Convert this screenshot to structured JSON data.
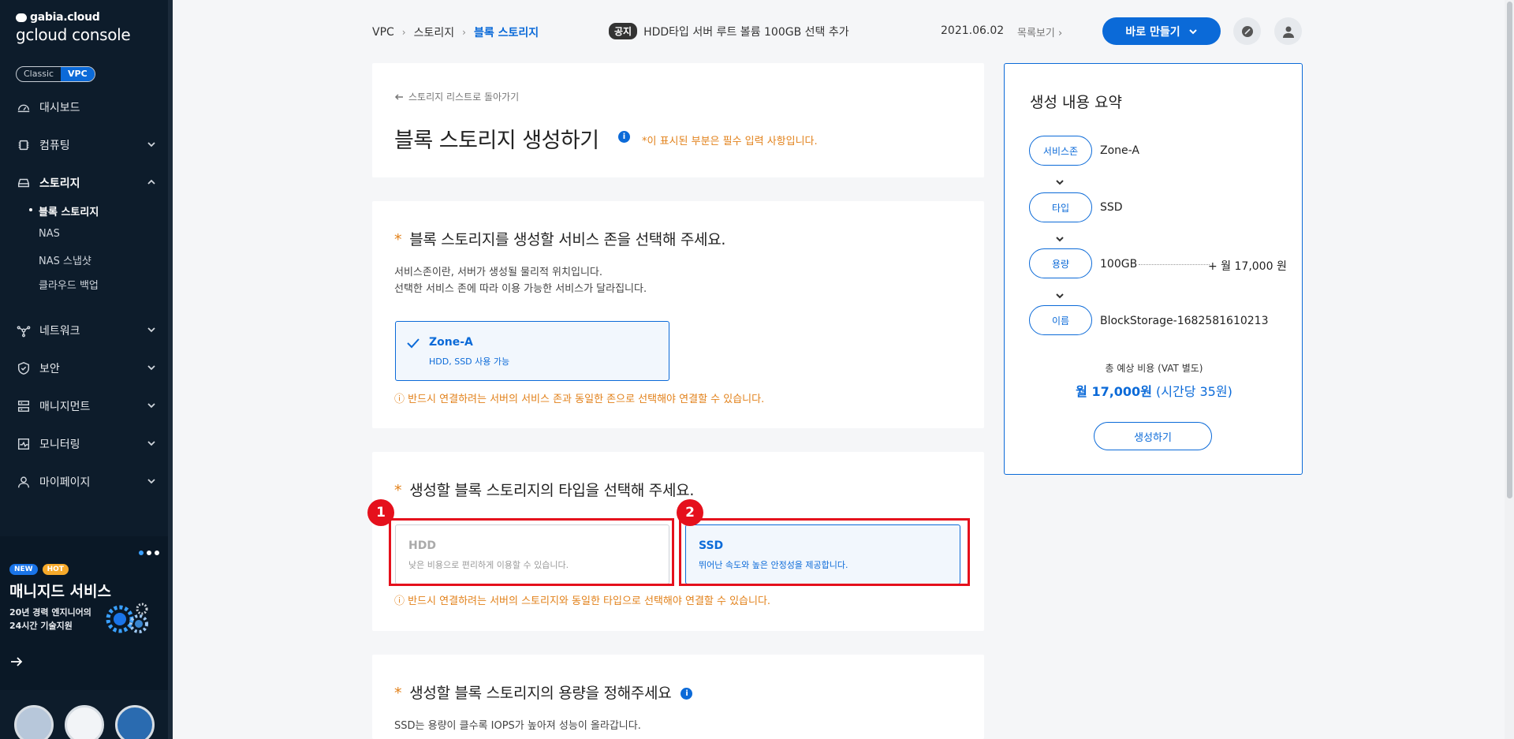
{
  "sidebar": {
    "logo_top": "gabia.cloud",
    "logo_bottom": "gcloud console",
    "toggle": {
      "classic": "Classic",
      "vpc": "VPC"
    },
    "items": [
      {
        "label": "대시보드",
        "icon": "dashboard-icon"
      },
      {
        "label": "컴퓨팅",
        "icon": "cpu-icon"
      },
      {
        "label": "스토리지",
        "icon": "storage-icon"
      },
      {
        "label": "네트워크",
        "icon": "network-icon"
      },
      {
        "label": "보안",
        "icon": "shield-icon"
      },
      {
        "label": "매니지먼트",
        "icon": "management-icon"
      },
      {
        "label": "모니터링",
        "icon": "monitor-icon"
      },
      {
        "label": "마이페이지",
        "icon": "user-icon"
      }
    ],
    "storage_sub": [
      "블록 스토리지",
      "NAS",
      "NAS 스냅샷",
      "클라우드 백업"
    ],
    "promo": {
      "badge_new": "NEW",
      "badge_hot": "HOT",
      "title": "매니지드 서비스",
      "desc1": "20년 경력 엔지니어의",
      "desc2": "24시간 기술지원"
    }
  },
  "topbar": {
    "crumbs": [
      "VPC",
      "스토리지",
      "블록 스토리지"
    ],
    "notice_tag": "공지",
    "notice_text": "HDD타입 서버 루트 볼륨 100GB 선택 추가",
    "notice_date": "2021.06.02",
    "notice_list": "목록보기",
    "make_button": "바로 만들기"
  },
  "header_card": {
    "back_link": "스토리지 리스트로 돌아가기",
    "title": "블록 스토리지 생성하기",
    "required_note": "*이 표시된 부분은 필수 입력 사항입니다."
  },
  "zone_section": {
    "title": "블록 스토리지를 생성할 서비스 존을 선택해 주세요.",
    "desc1": "서비스존이란, 서버가 생성될 물리적 위치입니다.",
    "desc2": "선택한 서비스 존에 따라 이용 가능한 서비스가 달라집니다.",
    "option_name": "Zone-A",
    "option_desc": "HDD, SSD 사용 가능",
    "warning": "ⓘ 반드시 연결하려는 서버의 서비스 존과 동일한 존으로 선택해야 연결할 수 있습니다."
  },
  "type_section": {
    "title": "생성할 블록 스토리지의 타입을 선택해 주세요.",
    "options": [
      {
        "name": "HDD",
        "desc": "낮은 비용으로 편리하게 이용할 수 있습니다.",
        "selected": false
      },
      {
        "name": "SSD",
        "desc": "뛰어난 속도와 높은 안정성을 제공합니다.",
        "selected": true
      }
    ],
    "markers": [
      "1",
      "2"
    ],
    "warning": "ⓘ 반드시 연결하려는 서버의 스토리지와 동일한 타입으로 선택해야 연결할 수 있습니다."
  },
  "capacity_section": {
    "title": "생성할 블록 스토리지의 용량을 정해주세요",
    "desc1": "SSD는 용량이 클수록 IOPS가 높아져 성능이 올라갑니다."
  },
  "summary": {
    "title": "생성 내용 요약",
    "rows": [
      {
        "label": "서비스존",
        "value": "Zone-A"
      },
      {
        "label": "타입",
        "value": "SSD"
      },
      {
        "label": "용량",
        "value": "100GB"
      },
      {
        "label": "이름",
        "value": "BlockStorage-1682581610213"
      }
    ],
    "capacity_price": "+ 월 17,000 원",
    "total_label": "총 예상 비용 (VAT 별도)",
    "total_value": "월 17,000원",
    "total_hourly": " (시간당 35원)",
    "create_button": "생성하기"
  },
  "colors": {
    "accent": "#0b6ad8",
    "warning": "#e2811a",
    "highlight": "#e5101c",
    "sidebar": "#0d1c2b"
  }
}
